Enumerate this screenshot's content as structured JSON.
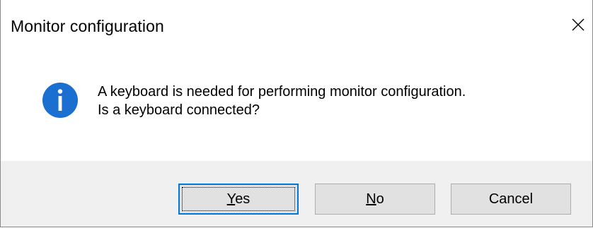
{
  "window": {
    "title": "Monitor configuration",
    "close_icon": "close-icon"
  },
  "message": {
    "icon": "info-icon",
    "line1": "A keyboard is needed for performing monitor configuration.",
    "line2": "Is a keyboard connected?"
  },
  "buttons": {
    "yes": {
      "mnemonic": "Y",
      "rest": "es",
      "label": "Yes"
    },
    "no": {
      "mnemonic": "N",
      "rest": "o",
      "label": "No"
    },
    "cancel": {
      "label": "Cancel"
    }
  },
  "colors": {
    "info_icon": "#1a6fd1",
    "default_button_border": "#0078d7",
    "footer_bg": "#f0f0f0"
  }
}
